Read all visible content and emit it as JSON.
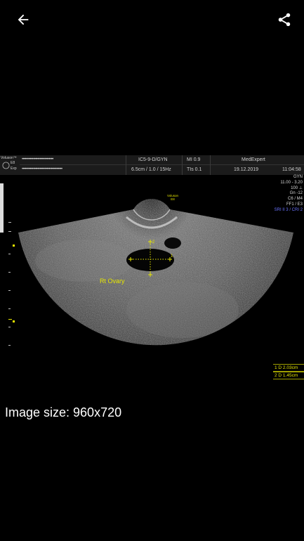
{
  "topbar": {
    "back_icon": "arrow-left-icon",
    "share_icon": "share-icon"
  },
  "ultrasound": {
    "brand": "Voluson™",
    "device": "E8",
    "exp": "Exp",
    "patient_mask_1": "••••••••••••••••••••••••••••",
    "patient_mask_2": "••••••••••••••••••••••••••••••••••••",
    "probe": "IC5-9-D/GYN",
    "depth_info": "6.5cm / 1.0 / 15Hz",
    "mi": "MI  0.9",
    "tis": "TIs  0.1",
    "institution": "MedExpert",
    "date": "19.12.2019",
    "time": "11:04:58",
    "center_label_1": "Voluson",
    "center_label_2": "E8",
    "params": [
      "GYN",
      "11.00 - 3.20",
      "100 ⊥",
      "Gn -12",
      "C6 / M4",
      "FF1 / E3"
    ],
    "params_blue": "SRI II 3 / CRI 2",
    "annotation": "Rt Ovary",
    "measurements": [
      {
        "label": "1  D 2.03cm"
      },
      {
        "label": "2  D 1.45cm"
      }
    ]
  },
  "caption": "Image size: 960x720",
  "colors": {
    "background": "#000000",
    "annotation": "#e6e600",
    "accent_blue": "#6b73ff"
  }
}
